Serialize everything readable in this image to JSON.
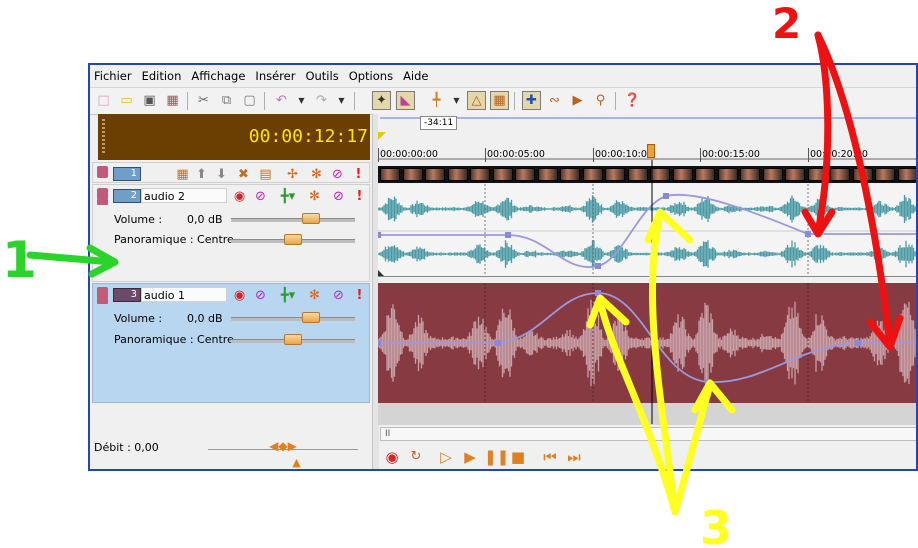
{
  "menu": [
    "Fichier",
    "Edition",
    "Affichage",
    "Insérer",
    "Outils",
    "Options",
    "Aide"
  ],
  "toolbar_icons": [
    "new-file",
    "open-folder",
    "save",
    "properties",
    "cut",
    "copy",
    "paste",
    "undo",
    "redo",
    "envelope-tool",
    "event-tool",
    "split-tool",
    "lock-envelopes",
    "auto-ripple",
    "snap",
    "envelope-edit",
    "selection",
    "zoom",
    "what-is-this"
  ],
  "timecode": "00:00:12:17",
  "ruler": {
    "bubble": "-34:11",
    "labels": [
      "00:00:00:00",
      "00:00:05:00",
      "00:00:10:00",
      "00:00:15:00",
      "00:00:20:00"
    ]
  },
  "video_track": {
    "number": "1"
  },
  "tracks": [
    {
      "number": "2",
      "name": "audio 2",
      "volume_label": "Volume :",
      "volume_value": "0,0 dB",
      "pan_label": "Panoramique : Centre",
      "volume_level": 0.78,
      "pan_level": 0.5
    },
    {
      "number": "3",
      "name": "audio 1",
      "volume_label": "Volume :",
      "volume_value": "0,0 dB",
      "pan_label": "Panoramique : Centre",
      "volume_level": 0.78,
      "pan_level": 0.5
    }
  ],
  "debit": "Débit : 0,00",
  "scroll_arrow": "II",
  "annotations": {
    "green": "1",
    "red": "2",
    "yellow": "3"
  },
  "colors": {
    "window_border": "#2046b8",
    "timecode_bg": "#6b3e02",
    "timecode_text": "#ffe400",
    "waveform_teal": "#4a9aa4",
    "selected_track_bg": "#873a42",
    "selected_header_bg": "#b9d6f0",
    "envelope": "#9a99dd",
    "annotation_green": "#2ad42a",
    "annotation_red": "#ee1111",
    "annotation_yellow": "#ffff22"
  }
}
